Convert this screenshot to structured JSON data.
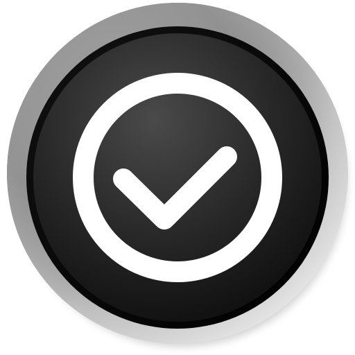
{
  "icon": {
    "name": "check-circle-icon",
    "colors": {
      "background": "#ffffff",
      "bezel_light": "#e8e8e8",
      "bezel_dark": "#6e6e6e",
      "face_center": "#4a4a4a",
      "face_edge": "#0c0c0c",
      "glyph": "#ffffff"
    }
  }
}
